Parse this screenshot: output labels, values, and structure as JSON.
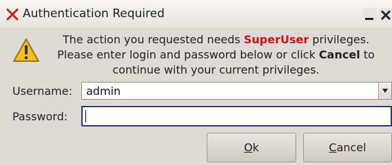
{
  "window": {
    "title": "Authentication Required"
  },
  "message": {
    "line1_pre": "The action you requested needs ",
    "line1_highlight": "SuperUser",
    "line1_post": " privileges.",
    "line2_pre": "Please enter login and password below or click ",
    "line2_bold": "Cancel",
    "line2_post": " to",
    "line3": "continue with your current privileges."
  },
  "form": {
    "username_label": "Username:",
    "username_value": "admin",
    "password_label": "Password:"
  },
  "buttons": {
    "ok_mnemonic": "O",
    "ok_rest": "k",
    "cancel_mnemonic": "C",
    "cancel_rest": "ancel"
  },
  "icons": {
    "close_mark": "x-icon",
    "warning": "warning-icon",
    "minimize": "minimize-icon",
    "close": "close-icon",
    "dropdown": "chevron-down-icon"
  },
  "colors": {
    "highlight_red": "#d11212",
    "focus_border": "#2a3d7a"
  }
}
